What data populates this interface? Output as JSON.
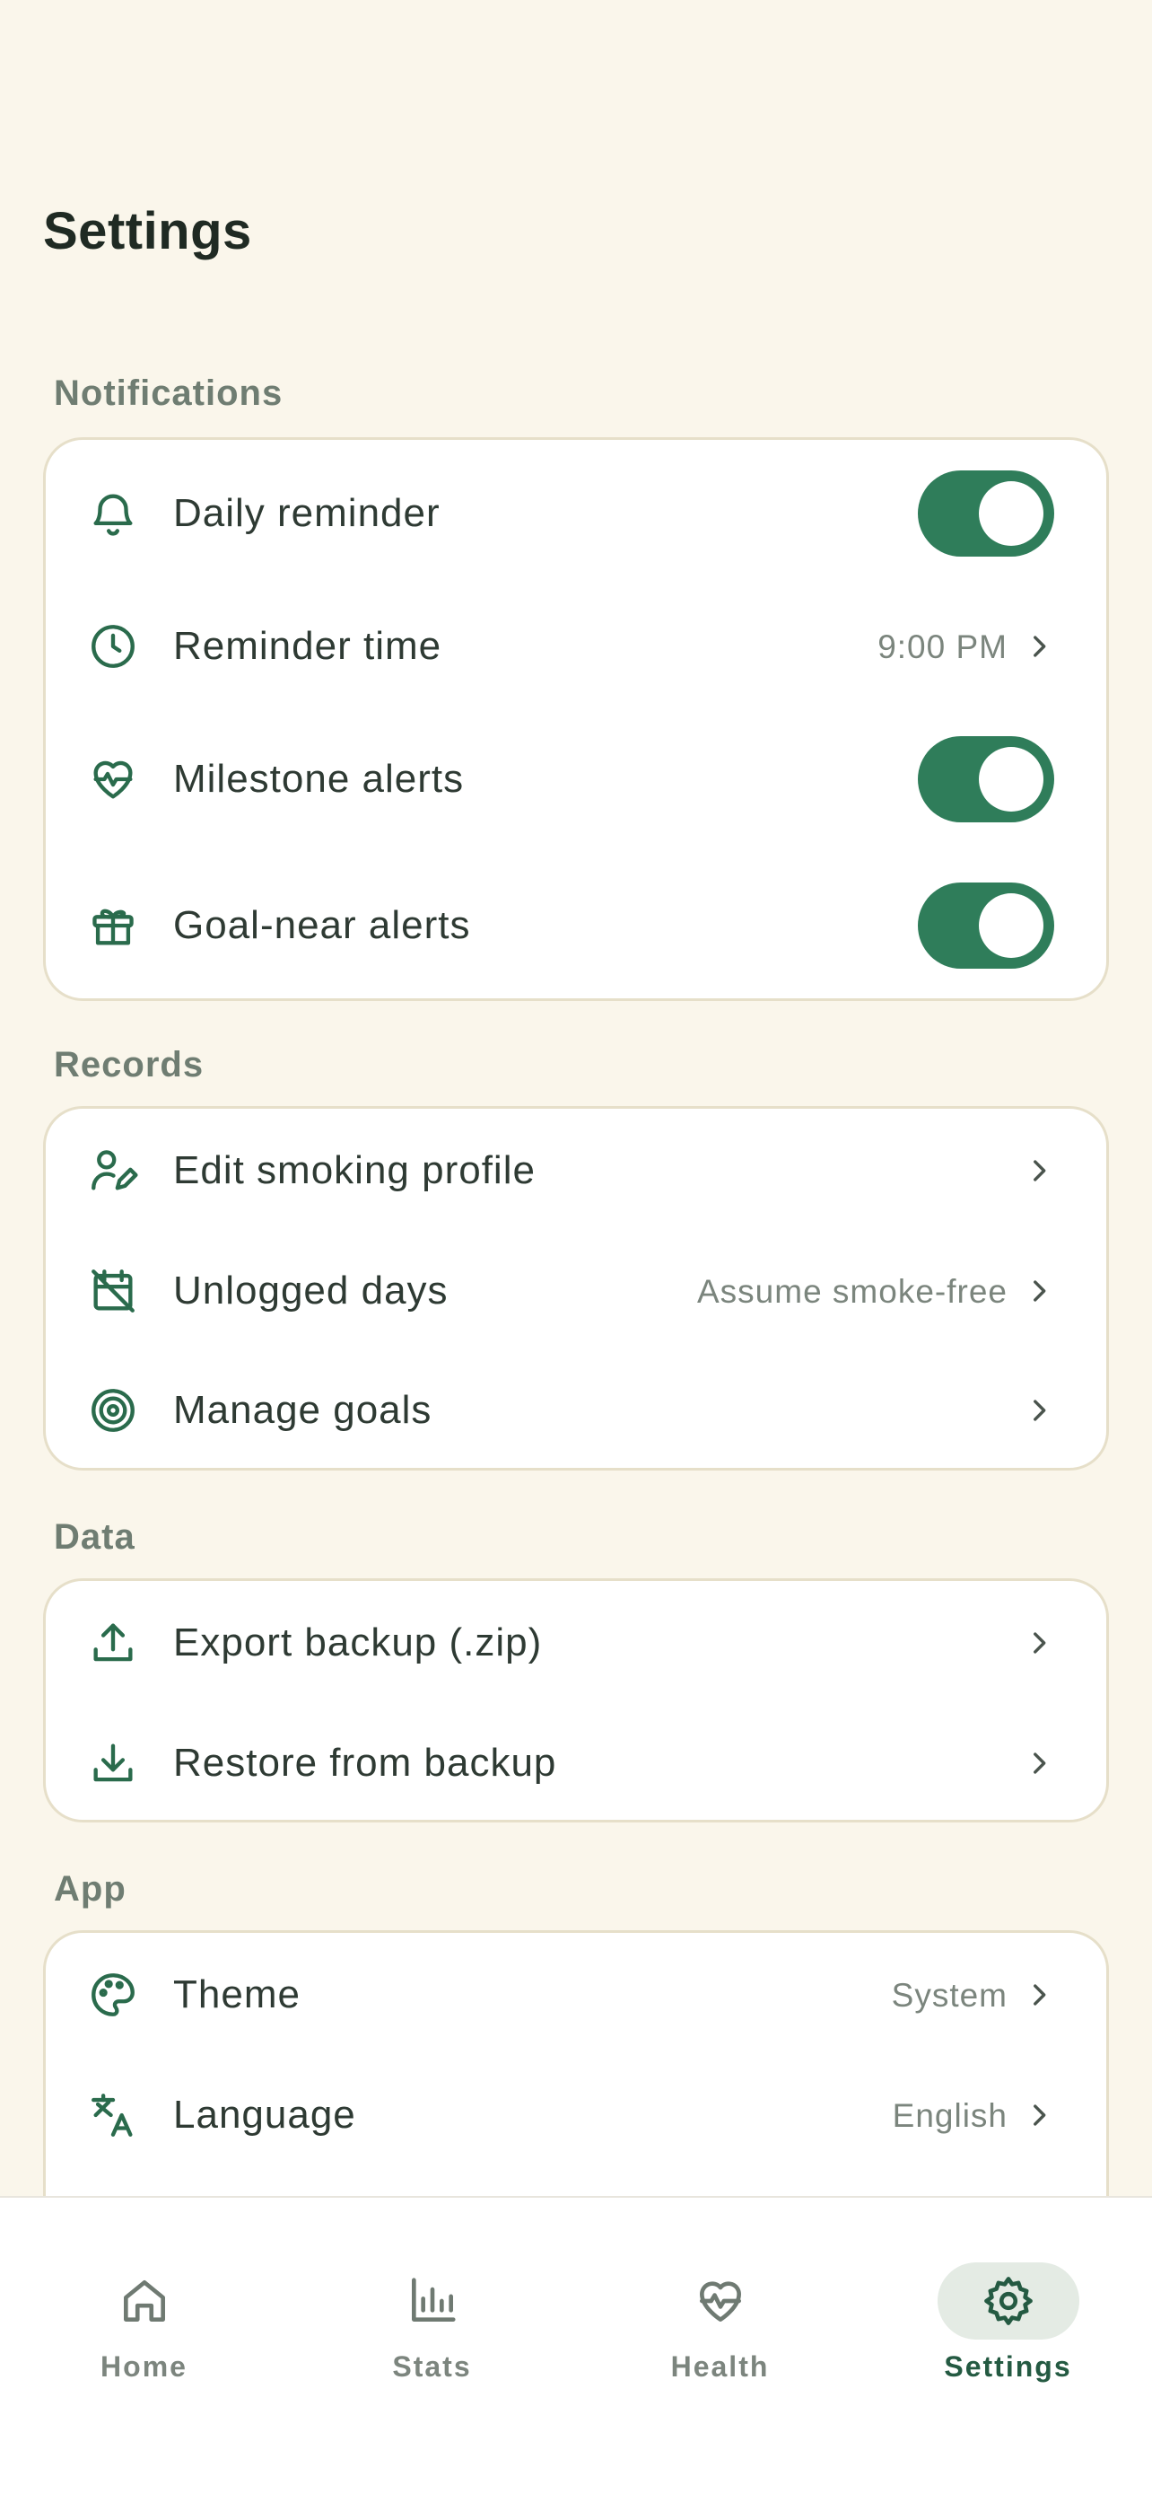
{
  "page": {
    "title": "Settings"
  },
  "sections": {
    "notifications": {
      "label": "Notifications",
      "daily_reminder": {
        "label": "Daily reminder",
        "enabled": true
      },
      "reminder_time": {
        "label": "Reminder time",
        "value": "9:00 PM"
      },
      "milestone_alerts": {
        "label": "Milestone alerts",
        "enabled": true
      },
      "goal_near_alerts": {
        "label": "Goal-near alerts",
        "enabled": true
      }
    },
    "records": {
      "label": "Records",
      "edit_profile": {
        "label": "Edit smoking profile"
      },
      "unlogged_days": {
        "label": "Unlogged days",
        "value": "Assume smoke-free"
      },
      "manage_goals": {
        "label": "Manage goals"
      }
    },
    "data": {
      "label": "Data",
      "export_backup": {
        "label": "Export backup (.zip)"
      },
      "restore_backup": {
        "label": "Restore from backup"
      }
    },
    "app": {
      "label": "App",
      "theme": {
        "label": "Theme",
        "value": "System"
      },
      "language": {
        "label": "Language",
        "value": "English"
      }
    }
  },
  "nav": {
    "home": "Home",
    "stats": "Stats",
    "health": "Health",
    "settings": "Settings",
    "active": "settings"
  },
  "colors": {
    "background": "#faf6eb",
    "accent": "#2f7d5a",
    "icon": "#2a6b4c",
    "card_border": "#e6dfc9"
  }
}
